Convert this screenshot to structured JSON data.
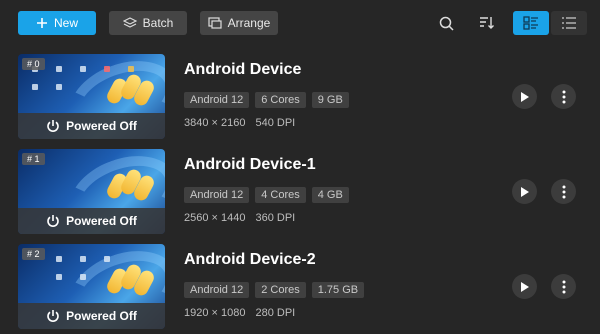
{
  "toolbar": {
    "new_label": "New",
    "batch_label": "Batch",
    "arrange_label": "Arrange"
  },
  "devices": [
    {
      "index": "# 0",
      "name": "Android Device",
      "android": "Android 12",
      "cores": "6 Cores",
      "ram": "9 GB",
      "resolution": "3840 × 2160",
      "dpi": "540 DPI",
      "status": "Powered Off"
    },
    {
      "index": "# 1",
      "name": "Android Device-1",
      "android": "Android 12",
      "cores": "4 Cores",
      "ram": "4 GB",
      "resolution": "2560 × 1440",
      "dpi": "360 DPI",
      "status": "Powered Off"
    },
    {
      "index": "# 2",
      "name": "Android Device-2",
      "android": "Android 12",
      "cores": "2 Cores",
      "ram": "1.75 GB",
      "resolution": "1920 × 1080",
      "dpi": "280 DPI",
      "status": "Powered Off"
    }
  ],
  "colors": {
    "accent": "#1aa3e8",
    "background": "#262626",
    "button": "#454545"
  },
  "icons": {
    "new": "plus-icon",
    "batch": "layers-icon",
    "arrange": "windows-icon",
    "search": "search-icon",
    "sort": "sort-icon",
    "view_detail": "detail-list-icon",
    "view_compact": "compact-list-icon",
    "power": "power-icon",
    "play": "play-icon",
    "more": "more-vertical-icon"
  }
}
